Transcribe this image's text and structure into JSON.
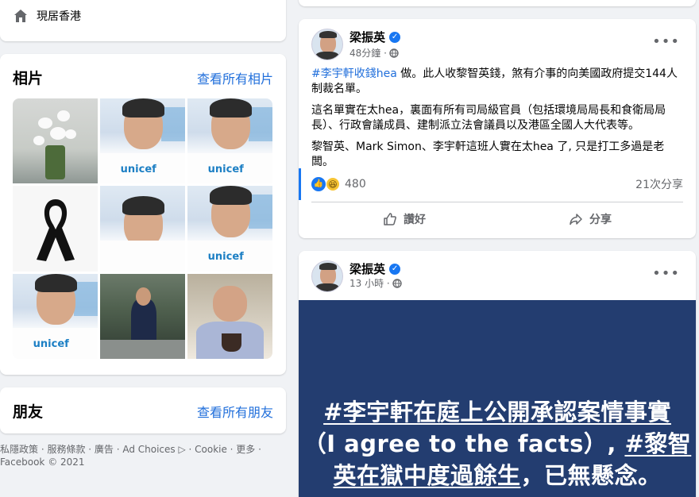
{
  "location": {
    "icon": "home-icon",
    "text": "現居香港"
  },
  "photos": {
    "title": "相片",
    "see_all": "查看所有相片",
    "items": [
      {
        "kind": "flowers"
      },
      {
        "kind": "unicef",
        "text": "unicef"
      },
      {
        "kind": "unicef",
        "text": "unicef"
      },
      {
        "kind": "ribbon"
      },
      {
        "kind": "unicef",
        "text": ""
      },
      {
        "kind": "unicef",
        "text": "unicef"
      },
      {
        "kind": "unicef",
        "text": "unicef"
      },
      {
        "kind": "kitchen"
      },
      {
        "kind": "coffee"
      }
    ]
  },
  "friends": {
    "title": "朋友",
    "see_all": "查看所有朋友"
  },
  "footer": {
    "line1": "私隱政策 · 服務條款 · 廣告 · Ad Choices ▷ · Cookie · 更多 ·",
    "line2": "Facebook © 2021"
  },
  "post1": {
    "author": "梁振英",
    "verified_icon": "✓",
    "time": "48分鐘 ·",
    "privacy_icon": "globe-icon",
    "menu": "•••",
    "hashtag": "#李宇軒收錢hea",
    "para1_rest": " 做。此人收黎智英錢，煞有介事的向美國政府提交144人制裁名單。",
    "para2": "這名單實在太hea，裏面有所有司局級官員（包括環境局局長和食衛局局長）、行政會議成員、建制派立法會議員以及港區全國人大代表等。",
    "para3": "黎智英、Mark Simon、李宇軒這班人實在太hea 了, 只是打工多過是老闆。",
    "reaction_count": "480",
    "shares": "21次分享",
    "like_label": "讚好",
    "share_label": "分享"
  },
  "post2": {
    "author": "梁振英",
    "verified_icon": "✓",
    "time": "13 小時 ·",
    "menu": "•••",
    "image_line1": "#李宇軒在庭上公開承認案情事實",
    "image_line2_a": "（I agree to the facts）, ",
    "image_line2_b": "#黎智",
    "image_line3_a": "英在獄中度過餘生",
    "image_line3_b": "，已無懸念。"
  },
  "colors": {
    "link": "#216fdb",
    "brand": "#1877f2",
    "image_bg": "#233d70"
  }
}
